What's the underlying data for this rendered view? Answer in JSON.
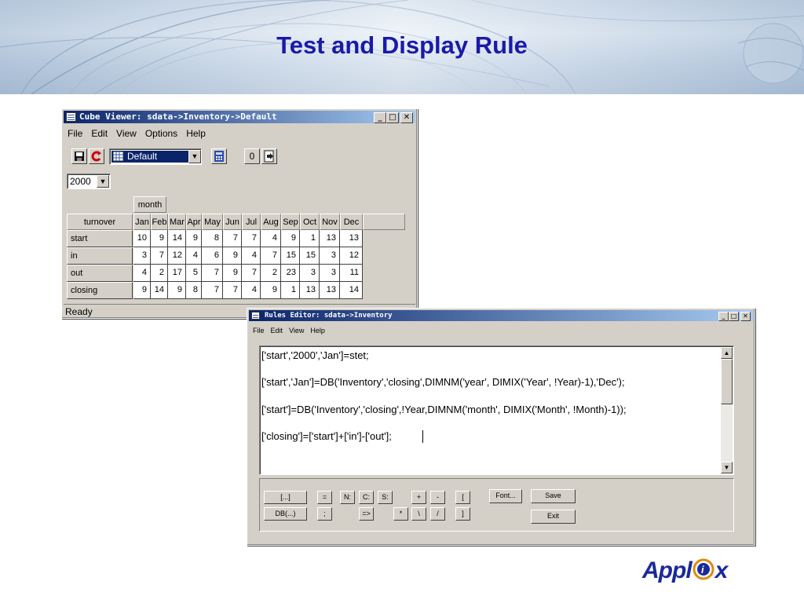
{
  "slide": {
    "title": "Test and Display Rule",
    "logo_text_left": "Appl",
    "logo_text_right": "x"
  },
  "cube_viewer": {
    "title": "Cube Viewer:  sdata->Inventory->Default",
    "menu": [
      "File",
      "Edit",
      "View",
      "Options",
      "Help"
    ],
    "view_select": "Default",
    "zero_button": "0",
    "year_select": "2000",
    "column_dimension": "month",
    "row_dimension": "turnover",
    "columns": [
      "Jan",
      "Feb",
      "Mar",
      "Apr",
      "May",
      "Jun",
      "Jul",
      "Aug",
      "Sep",
      "Oct",
      "Nov",
      "Dec"
    ],
    "rows": [
      {
        "label": "start",
        "values": [
          "10",
          "9",
          "14",
          "9",
          "8",
          "7",
          "7",
          "4",
          "9",
          "1",
          "13",
          "13"
        ]
      },
      {
        "label": "in",
        "values": [
          "3",
          "7",
          "12",
          "4",
          "6",
          "9",
          "4",
          "7",
          "15",
          "15",
          "3",
          "12"
        ]
      },
      {
        "label": "out",
        "values": [
          "4",
          "2",
          "17",
          "5",
          "7",
          "9",
          "7",
          "2",
          "23",
          "3",
          "3",
          "11"
        ]
      },
      {
        "label": "closing",
        "values": [
          "9",
          "14",
          "9",
          "8",
          "7",
          "7",
          "4",
          "9",
          "1",
          "13",
          "13",
          "14"
        ]
      }
    ],
    "status": "Ready"
  },
  "rules_editor": {
    "title": "Rules Editor:  sdata->Inventory",
    "menu": [
      "File",
      "Edit",
      "View",
      "Help"
    ],
    "lines": [
      "['start','2000','Jan']=stet;",
      "['start','Jan']=DB('Inventory','closing',DIMNM('year', DIMIX('Year', !Year)-1),'Dec');",
      "['start']=DB('Inventory','closing',!Year,DIMNM('month', DIMIX('Month', !Month)-1));",
      "['closing']=['start']+['in']-['out'];"
    ],
    "buttons": {
      "bracket_dots": "[...]",
      "equals": "=",
      "n": "N:",
      "c": "C:",
      "s": "S:",
      "plus": "+",
      "minus": "-",
      "lbracket": "[",
      "font": "Font...",
      "save": "Save",
      "db": "DB(...)",
      "semicolon": ";",
      "arrow": "=>",
      "times": "*",
      "backslash": "\\",
      "slash": "/",
      "rbracket": "]",
      "exit": "Exit"
    }
  }
}
